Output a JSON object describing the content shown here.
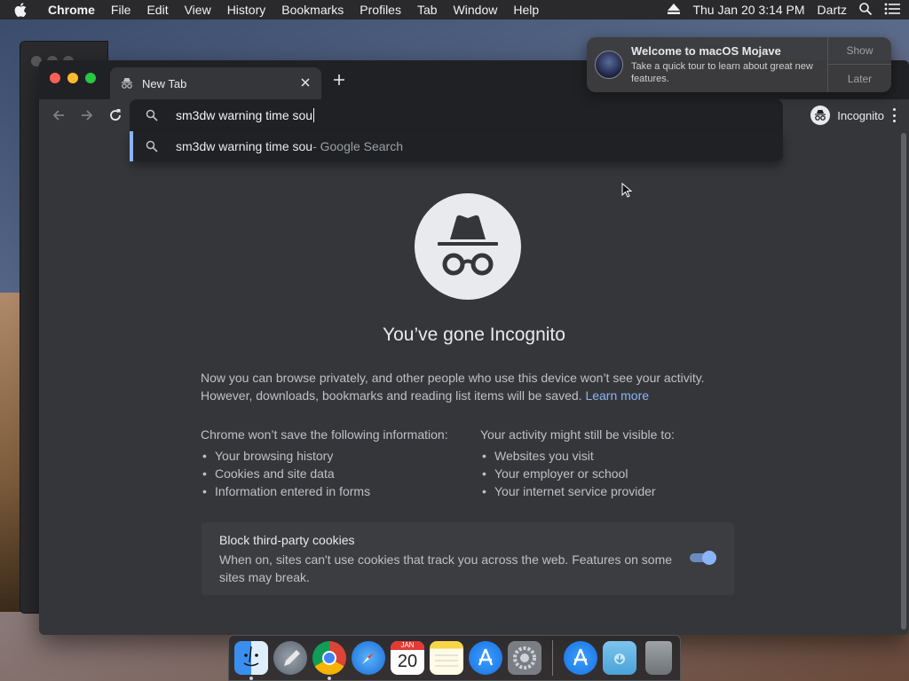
{
  "menubar": {
    "app_name": "Chrome",
    "items": [
      "File",
      "Edit",
      "View",
      "History",
      "Bookmarks",
      "Profiles",
      "Tab",
      "Window",
      "Help"
    ],
    "clock": "Thu Jan 20  3:14 PM",
    "user": "Dartz"
  },
  "tab": {
    "title": "New Tab"
  },
  "omnibox": {
    "value": "sm3dw warning time sou"
  },
  "profile": {
    "label": "Incognito"
  },
  "suggestion": {
    "query": "sm3dw warning time sou",
    "suffix": " - Google Search"
  },
  "incognito": {
    "headline": "You’ve gone Incognito",
    "intro": "Now you can browse privately, and other people who use this device won’t see your activity. However, downloads, bookmarks and reading list items will be saved.",
    "learn_more": "Learn more",
    "left_heading": "Chrome won’t save the following information:",
    "left_items": [
      "Your browsing history",
      "Cookies and site data",
      "Information entered in forms"
    ],
    "right_heading": "Your activity might still be visible to:",
    "right_items": [
      "Websites you visit",
      "Your employer or school",
      "Your internet service provider"
    ],
    "cookie_title": "Block third-party cookies",
    "cookie_desc": "When on, sites can't use cookies that track you across the web. Features on some sites may break.",
    "cookie_toggle_on": true
  },
  "notification": {
    "title": "Welcome to macOS Mojave",
    "body": "Take a quick tour to learn about great new features.",
    "show": "Show",
    "later": "Later"
  },
  "dock": {
    "icons": [
      "finder-icon",
      "launchpad-icon",
      "chrome-icon",
      "safari-icon",
      "calendar-icon",
      "notes-icon",
      "app-store-icon",
      "system-preferences-icon",
      "app-store-icon",
      "downloads-folder-icon",
      "trash-icon"
    ],
    "calendar_month": "JAN",
    "calendar_day": "20"
  },
  "colors": {
    "accent": "#8ab4f8",
    "page_bg": "#35363a",
    "tabstrip_bg": "#202124"
  }
}
